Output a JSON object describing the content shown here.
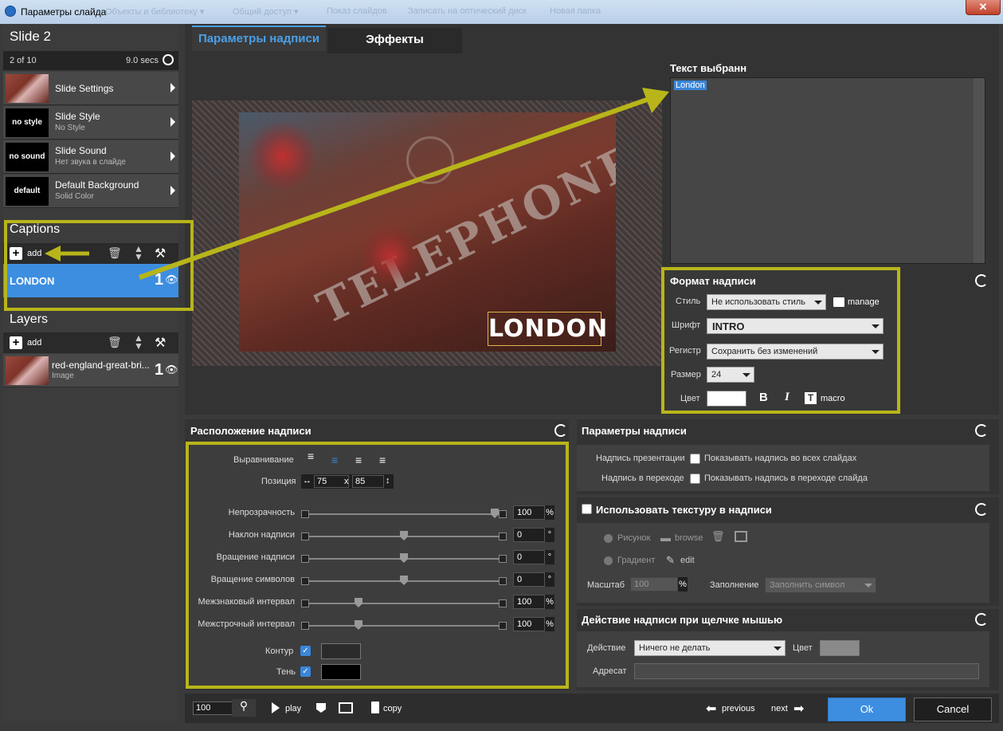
{
  "window": {
    "title": "Параметры слайда",
    "ghost_menu": [
      "Объекты и библиотеку ▾",
      "Общий доступ ▾",
      "Показ слайдов",
      "Записать на оптический диск",
      "Новая папка"
    ]
  },
  "left": {
    "slide_title": "Slide 2",
    "position": "2 of 10",
    "duration": "9.0 secs",
    "rows": [
      {
        "title": "Slide Settings",
        "sub": "",
        "thumb": ""
      },
      {
        "title": "Slide Style",
        "sub": "No Style",
        "thumb": "no style"
      },
      {
        "title": "Slide Sound",
        "sub": "Нет звука в слайде",
        "thumb": "no sound"
      },
      {
        "title": "Default Background",
        "sub": "Solid Color",
        "thumb": "default"
      }
    ],
    "captions_header": "Captions",
    "add_label": "add",
    "caption_item": {
      "text": "LONDON",
      "num": "1"
    },
    "layers_header": "Layers",
    "layer_item": {
      "title": "red-england-great-bri...",
      "sub": "Image",
      "num": "1"
    }
  },
  "tabs": [
    {
      "label": "Параметры надписи",
      "active": true
    },
    {
      "label": "Эффекты",
      "active": false
    }
  ],
  "preview": {
    "caption": "LONDON",
    "words": [
      "TELEPHONE"
    ]
  },
  "text_panel": {
    "header": "Текст выбранн",
    "value": "London"
  },
  "format": {
    "header": "Формат надписи",
    "style_label": "Стиль",
    "style_value": "Не использовать стиль",
    "manage": "manage",
    "font_label": "Шрифт",
    "font_value": "INTRO",
    "case_label": "Регистр",
    "case_value": "Сохранить без изменений",
    "size_label": "Размер",
    "size_value": "24",
    "color_label": "Цвет",
    "macro": "macro",
    "color": "#ffffff"
  },
  "position_panel": {
    "header": "Расположение надписи",
    "align_label": "Выравнивание",
    "pos_label": "Позиция",
    "pos_x": "75",
    "pos_sep": "x",
    "pos_y": "85",
    "sliders": [
      {
        "label": "Непрозрачность",
        "value": "100",
        "unit": "%",
        "fraction": 1.0
      },
      {
        "label": "Наклон надписи",
        "value": "0",
        "unit": "°",
        "fraction": 0.5
      },
      {
        "label": "Вращение надписи",
        "value": "0",
        "unit": "°",
        "fraction": 0.5
      },
      {
        "label": "Вращение символов",
        "value": "0",
        "unit": "°",
        "fraction": 0.5
      },
      {
        "label": "Межзнаковый интервал",
        "value": "100",
        "unit": "%",
        "fraction": 0.25
      },
      {
        "label": "Межстрочный интервал",
        "value": "100",
        "unit": "%",
        "fraction": 0.25
      }
    ],
    "outline_label": "Контур",
    "outline_color": "#2b2b2b",
    "shadow_label": "Тень",
    "shadow_color": "#000000"
  },
  "caption_params": {
    "header": "Параметры надписи",
    "pres_label": "Надпись презентации",
    "pres_check": "Показывать надпись во всех слайдах",
    "trans_label": "Надпись в переходе",
    "trans_check": "Показывать надпись в переходе слайда"
  },
  "texture": {
    "header": "Использовать текстуру в надписи",
    "picture": "Рисунок",
    "browse": "browse",
    "gradient": "Градиент",
    "edit": "edit",
    "scale_label": "Масштаб",
    "scale_value": "100",
    "scale_unit": "%",
    "fill_label": "Заполнение",
    "fill_value": "Заполнить символ"
  },
  "action": {
    "header": "Действие надписи при щелчке мышью",
    "action_label": "Действие",
    "action_value": "Ничего не делать",
    "color_label": "Цвет",
    "color": "#8a8a8a",
    "addr_label": "Адресат",
    "addr_value": ""
  },
  "bottom": {
    "zoom": "100",
    "play": "play",
    "copy": "copy",
    "previous": "previous",
    "next": "next",
    "ok": "Ok",
    "cancel": "Cancel"
  }
}
